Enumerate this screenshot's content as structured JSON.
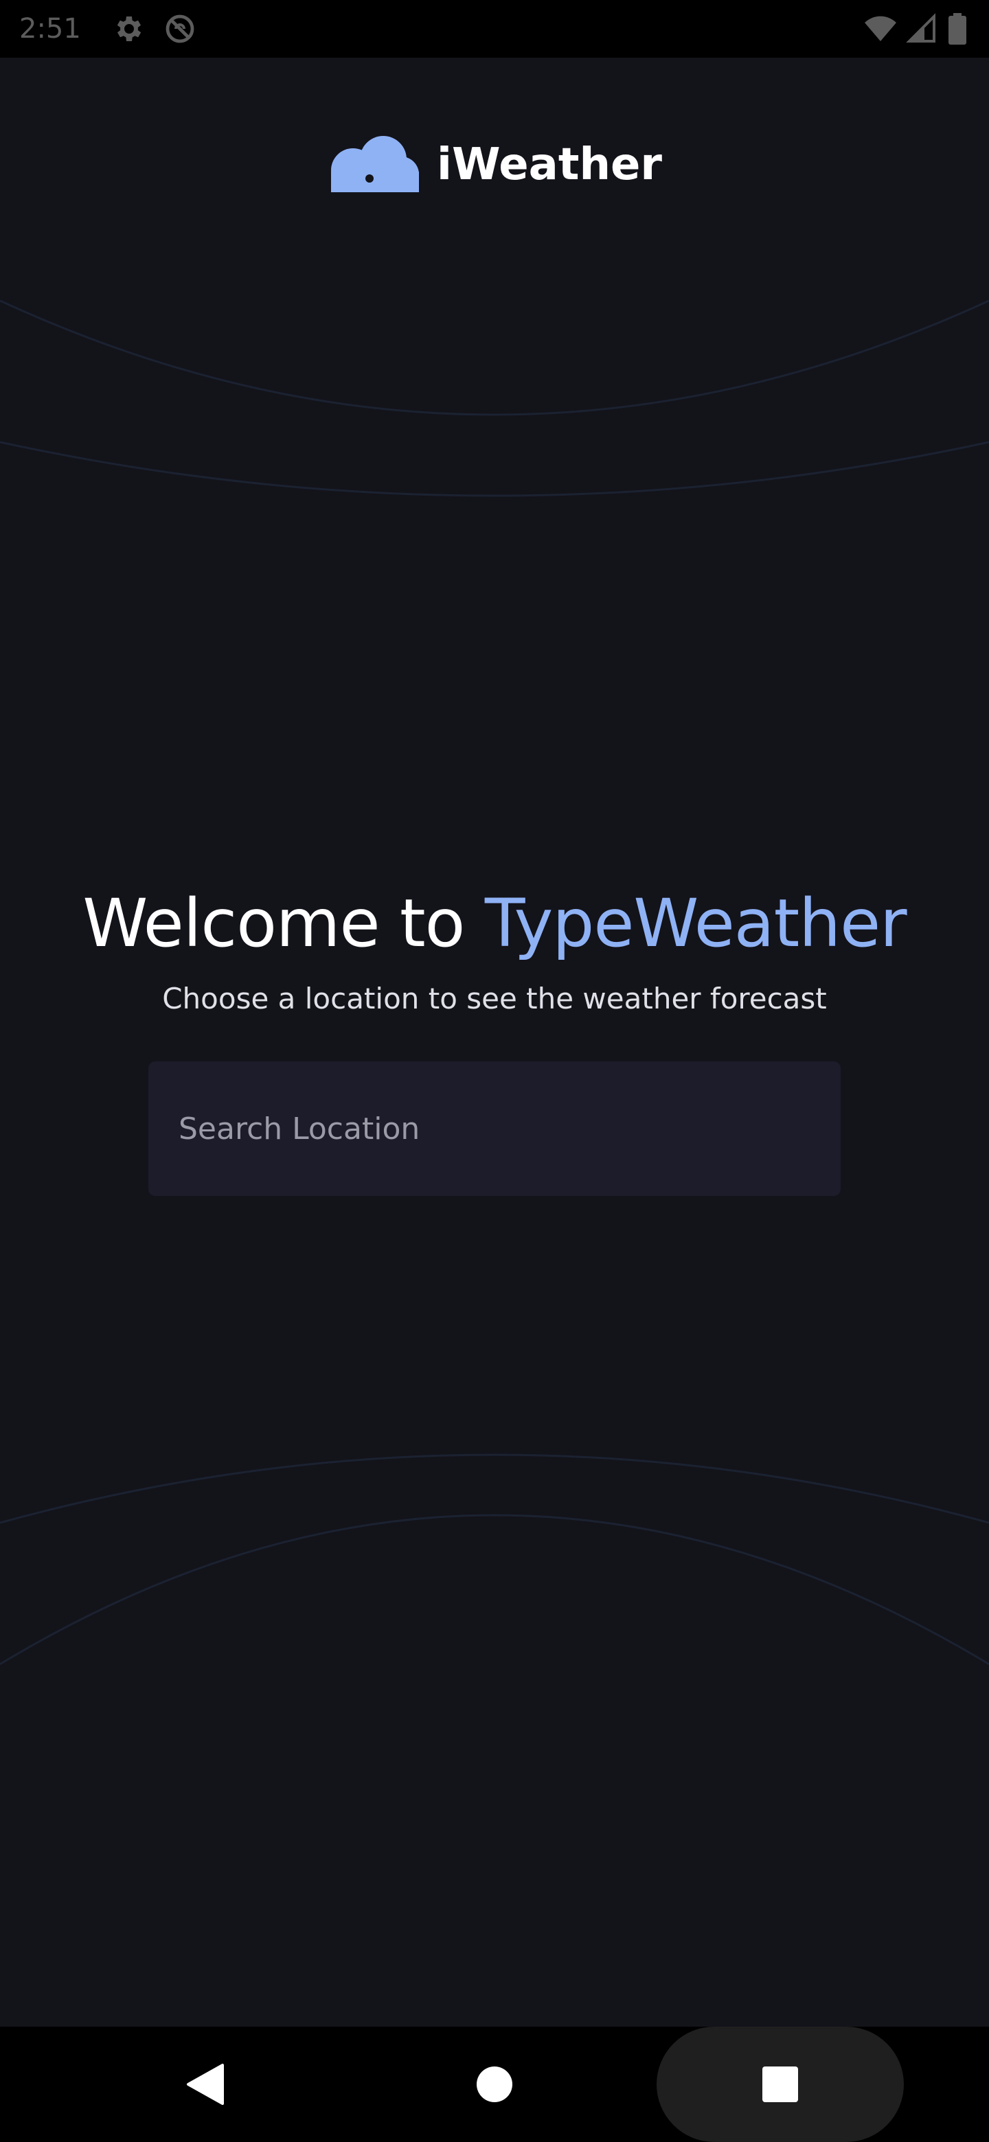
{
  "status_bar": {
    "time": "2:51",
    "left_icons": [
      "settings-icon",
      "do-not-disturb-icon"
    ],
    "right_icons": [
      "wifi-icon",
      "cellular-signal-icon",
      "battery-icon"
    ]
  },
  "app": {
    "name": "iWeather",
    "logo_icon": "cloud-logo-icon"
  },
  "hero": {
    "title_prefix": "Welcome to ",
    "title_accent": "TypeWeather",
    "subtitle": "Choose a location to see the weather forecast"
  },
  "search": {
    "value": "",
    "placeholder": "Search Location"
  },
  "nav_bar": {
    "buttons": [
      "back-icon",
      "home-icon",
      "recents-icon"
    ]
  },
  "colors": {
    "background": "#13131a",
    "accent": "#8fb2f5",
    "input_background": "#1c1c2b",
    "text_primary": "#ffffff",
    "placeholder": "#9b9ba8"
  }
}
